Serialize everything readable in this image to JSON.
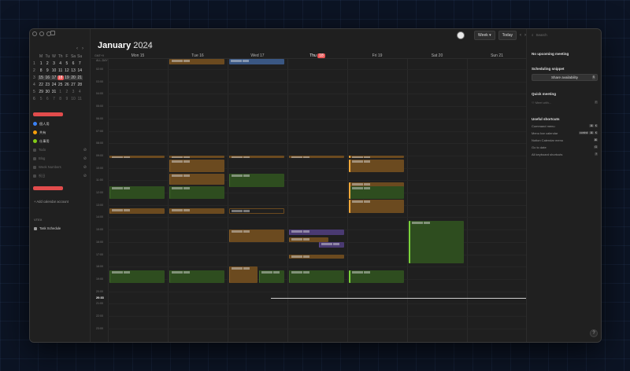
{
  "sidebar": {
    "mini_cal": {
      "weekday_headers": [
        "M",
        "Tu",
        "W",
        "Th",
        "F",
        "Sa",
        "Su"
      ],
      "weeks": [
        {
          "wk": "1",
          "days": [
            "1",
            "2",
            "3",
            "4",
            "5",
            "6",
            "7"
          ]
        },
        {
          "wk": "2",
          "days": [
            "8",
            "9",
            "10",
            "11",
            "12",
            "13",
            "14"
          ]
        },
        {
          "wk": "3",
          "days": [
            "15",
            "16",
            "17",
            "18",
            "19",
            "20",
            "21"
          ]
        },
        {
          "wk": "4",
          "days": [
            "22",
            "23",
            "24",
            "25",
            "26",
            "27",
            "28"
          ]
        },
        {
          "wk": "5",
          "days": [
            "29",
            "30",
            "31",
            "1",
            "2",
            "3",
            "4"
          ]
        },
        {
          "wk": "6",
          "days": [
            "5",
            "6",
            "7",
            "8",
            "9",
            "10",
            "11"
          ]
        }
      ],
      "today": "18"
    },
    "calendars": [
      {
        "label": "個人用",
        "color": "#3b82f6"
      },
      {
        "label": "共有",
        "color": "#f59e0b"
      },
      {
        "label": "仕事用",
        "color": "#84cc16"
      }
    ],
    "hidden_calendars": [
      {
        "label": "Todo"
      },
      {
        "label": "Blog"
      },
      {
        "label": "Week Numbers"
      },
      {
        "label": "祝日"
      }
    ],
    "add_calendar": "+ Add calendar account",
    "section_label": "VTEX",
    "task_schedule": "Task Schedule"
  },
  "main": {
    "month": "January",
    "year": "2024",
    "week_label": "Week 3",
    "view_button": "Week",
    "today_button": "Today",
    "gmt_label": "GMT+9",
    "day_headers": [
      "Mon 15",
      "Tue 16",
      "Wed 17",
      "Thu",
      "Fri 19",
      "Sat 20",
      "Sun 21"
    ],
    "today_num": "18",
    "all_day_label": "ALL-DAY",
    "hours": [
      "02:00",
      "03:00",
      "04:00",
      "05:00",
      "06:00",
      "07:00",
      "08:00",
      "09:00",
      "10:00",
      "11:00",
      "12:00",
      "13:00",
      "14:00",
      "15:00",
      "16:00",
      "17:00",
      "18:00",
      "19:00",
      "20:00",
      "21:00",
      "22:00",
      "23:00"
    ],
    "now_label": "20:33"
  },
  "right_panel": {
    "search_placeholder": "Search",
    "no_meeting": "No upcoming meeting",
    "scheduling_title": "Scheduling snippet",
    "share_button": "Share availability",
    "share_key": "S",
    "quick_meeting_title": "Quick meeting",
    "meet_with_placeholder": "Meet with...",
    "meet_key": "F",
    "shortcuts_title": "Useful shortcuts",
    "shortcuts": [
      {
        "label": "Command menu",
        "keys": [
          "⌘",
          "K"
        ]
      },
      {
        "label": "Menu bar calendar",
        "keys": [
          "control",
          "⌘",
          "K"
        ]
      },
      {
        "label": "Notion Calendar menu",
        "keys": [
          "⌘"
        ]
      },
      {
        "label": "Go to date",
        "keys": [
          "G"
        ]
      },
      {
        "label": "All keyboard shortcuts",
        "keys": [
          "?"
        ]
      }
    ],
    "help": "?"
  },
  "colors": {
    "accent": "#eb5757",
    "event_brown": "#6b4a1f",
    "event_green": "#2e4d1f",
    "event_purple": "#4a3a72",
    "event_blue": "#3a5783"
  }
}
